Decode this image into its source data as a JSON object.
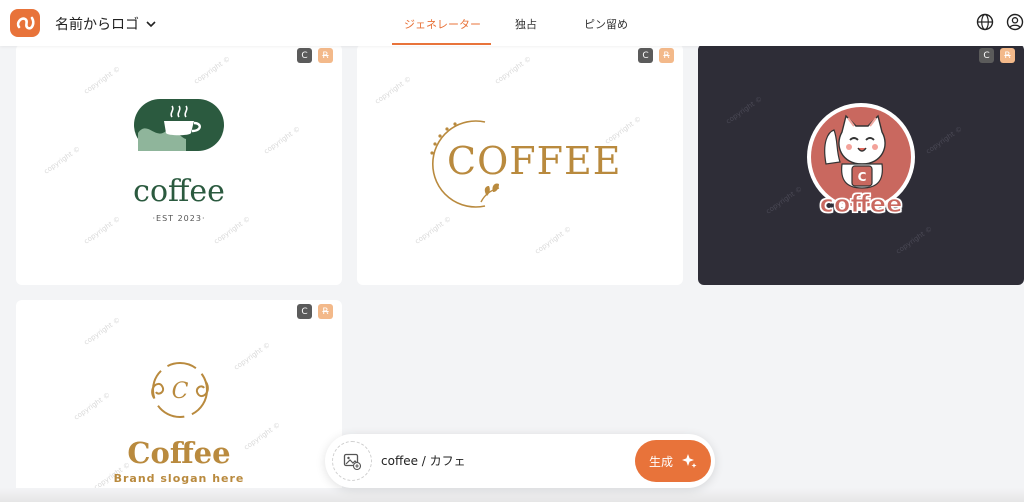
{
  "header": {
    "brand_label": "名前からロゴ",
    "tabs": [
      {
        "label": "ジェネレーター",
        "active": true
      },
      {
        "label": "独占",
        "active": false
      },
      {
        "label": "ピン留め",
        "active": false
      }
    ],
    "icons": [
      "globe-icon",
      "account-icon",
      "chevron-down-icon"
    ]
  },
  "badges": {
    "c": "C",
    "r": "R"
  },
  "watermark": "copyright ©",
  "cards": [
    {
      "word": "coffee",
      "sub": "·EST 2023·",
      "style": "green-cup"
    },
    {
      "word": "COFFEE",
      "style": "gold-ring"
    },
    {
      "word": "coffee",
      "letter": "C",
      "style": "cat-mascot"
    },
    {
      "word": "Coffee",
      "letter": "C",
      "sub": "Brand slogan here",
      "style": "gold-swirl"
    }
  ],
  "prompt": {
    "value": "coffee / カフェ",
    "generate_label": "生成"
  },
  "colors": {
    "accent": "#e8733a",
    "dark_card": "#2e2d37",
    "green": "#2b5a3f",
    "gold": "#b98a3e"
  }
}
